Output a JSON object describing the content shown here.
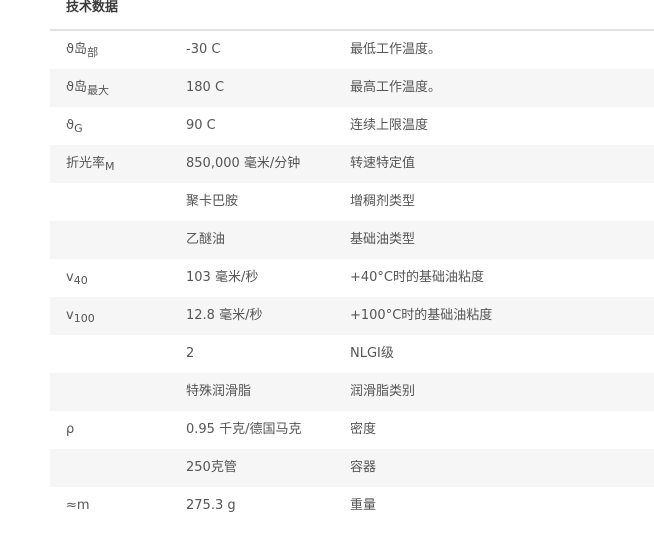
{
  "section_title": "技术数据",
  "rows": [
    {
      "symbol": "ϑ岛",
      "subscript": "部",
      "value": "-30 C",
      "description": "最低工作温度。"
    },
    {
      "symbol": "ϑ岛",
      "subscript": "最大",
      "value": "180 C",
      "description": "最高工作温度。"
    },
    {
      "symbol": "ϑ",
      "subscript": "G",
      "value": "90 C",
      "description": "连续上限温度"
    },
    {
      "symbol": "折光率",
      "subscript": "M",
      "value": "850,000 毫米/分钟",
      "description": "转速特定值"
    },
    {
      "symbol": "",
      "subscript": "",
      "value": "聚卡巴胺",
      "description": "增稠剂类型"
    },
    {
      "symbol": "",
      "subscript": "",
      "value": "乙醚油",
      "description": "基础油类型"
    },
    {
      "symbol": "v",
      "subscript": "40",
      "value": "103 毫米/秒",
      "description": "+40°C时的基础油粘度"
    },
    {
      "symbol": "v",
      "subscript": "100",
      "value": "12.8 毫米/秒",
      "description": "+100°C时的基础油粘度"
    },
    {
      "symbol": "",
      "subscript": "",
      "value": "2",
      "description": "NLGI级"
    },
    {
      "symbol": "",
      "subscript": "",
      "value": "特殊润滑脂",
      "description": "润滑脂类别"
    },
    {
      "symbol": "ρ",
      "subscript": "",
      "value": "0.95 千克/德国马克",
      "description": "密度"
    },
    {
      "symbol": "",
      "subscript": "",
      "value": "250克管",
      "description": "容器"
    },
    {
      "symbol": "≈m",
      "subscript": "",
      "value": "275.3 g",
      "description": "重量"
    }
  ]
}
